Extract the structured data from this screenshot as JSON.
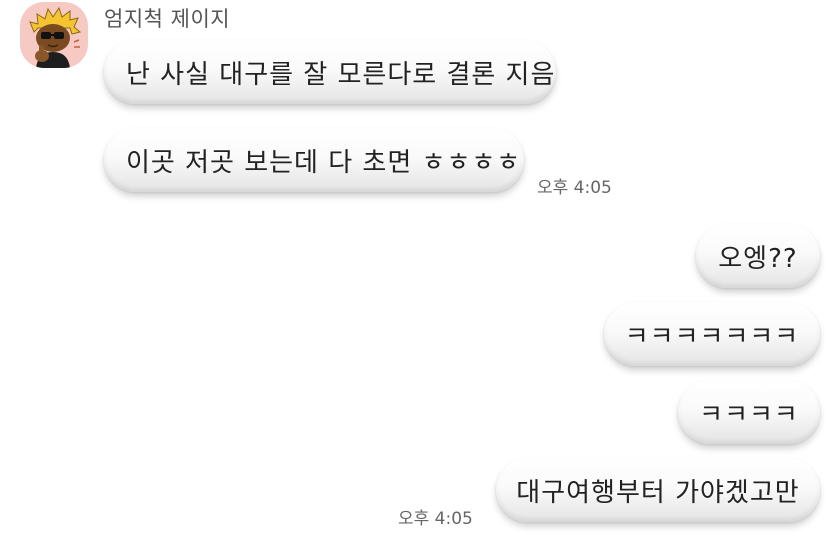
{
  "chat": {
    "sender_name": "엄지척 제이지",
    "messages": {
      "m1": "난 사실 대구를 잘 모른다로 결론 지음",
      "m2": "이곳 저곳 보는데 다 초면 ㅎㅎㅎㅎ",
      "m2_time": "오후 4:05",
      "m3": "오엥??",
      "m4": "ㅋㅋㅋㅋㅋㅋㅋ",
      "m5": "ㅋㅋㅋㅋ",
      "m6": "대구여행부터 가야겠고만",
      "m6_time": "오후 4:05"
    }
  },
  "colors": {
    "avatar_bg": "#f7c9c3",
    "bubble": "#f2f2f2",
    "text": "#222222",
    "meta_text": "#666666"
  },
  "icons": {
    "avatar": "character-avatar-icon"
  }
}
